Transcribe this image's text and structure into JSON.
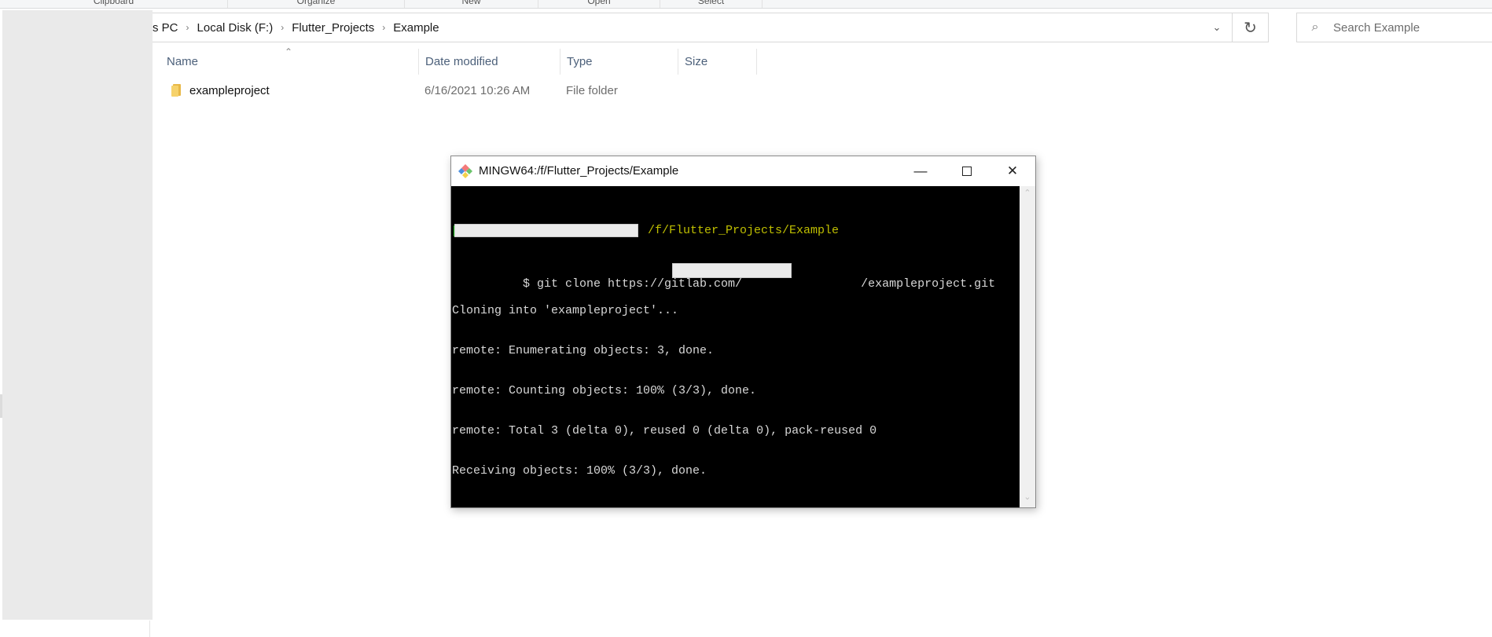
{
  "ribbon": {
    "groups": [
      "Clipboard",
      "Organize",
      "New",
      "Open",
      "Select"
    ]
  },
  "address_bar": {
    "breadcrumb": [
      "s PC",
      "Local Disk (F:)",
      "Flutter_Projects",
      "Example"
    ],
    "separator_icon": "chevron-right-icon",
    "dropdown_icon": "chevron-down-icon",
    "refresh_icon": "refresh-icon"
  },
  "search": {
    "placeholder": "Search Example",
    "value": ""
  },
  "file_list": {
    "columns": [
      "Name",
      "Date modified",
      "Type",
      "Size"
    ],
    "sort_column": "Name",
    "rows": [
      {
        "name": "exampleproject",
        "date_modified": "6/16/2021 10:26 AM",
        "type": "File folder",
        "size": "",
        "icon": "folder-icon"
      }
    ]
  },
  "terminal": {
    "title": "MINGW64:/f/Flutter_Projects/Example",
    "prompt_path": "/f/Flutter_Projects/Example",
    "command_prefix": "$ git clone https://gitlab.com/",
    "command_suffix": "/exampleproject.git",
    "output": [
      "Cloning into 'exampleproject'...",
      "remote: Enumerating objects: 3, done.",
      "remote: Counting objects: 100% (3/3), done.",
      "remote: Total 3 (delta 0), reused 0 (delta 0), pack-reused 0",
      "Receiving objects: 100% (3/3), done."
    ],
    "final_prompt": "$",
    "colors": {
      "background": "#000000",
      "text": "#d8d8d8",
      "path": "#bfbf00",
      "user": "#1fbf1f"
    },
    "buttons": {
      "minimize": "—",
      "close": "✕"
    }
  }
}
